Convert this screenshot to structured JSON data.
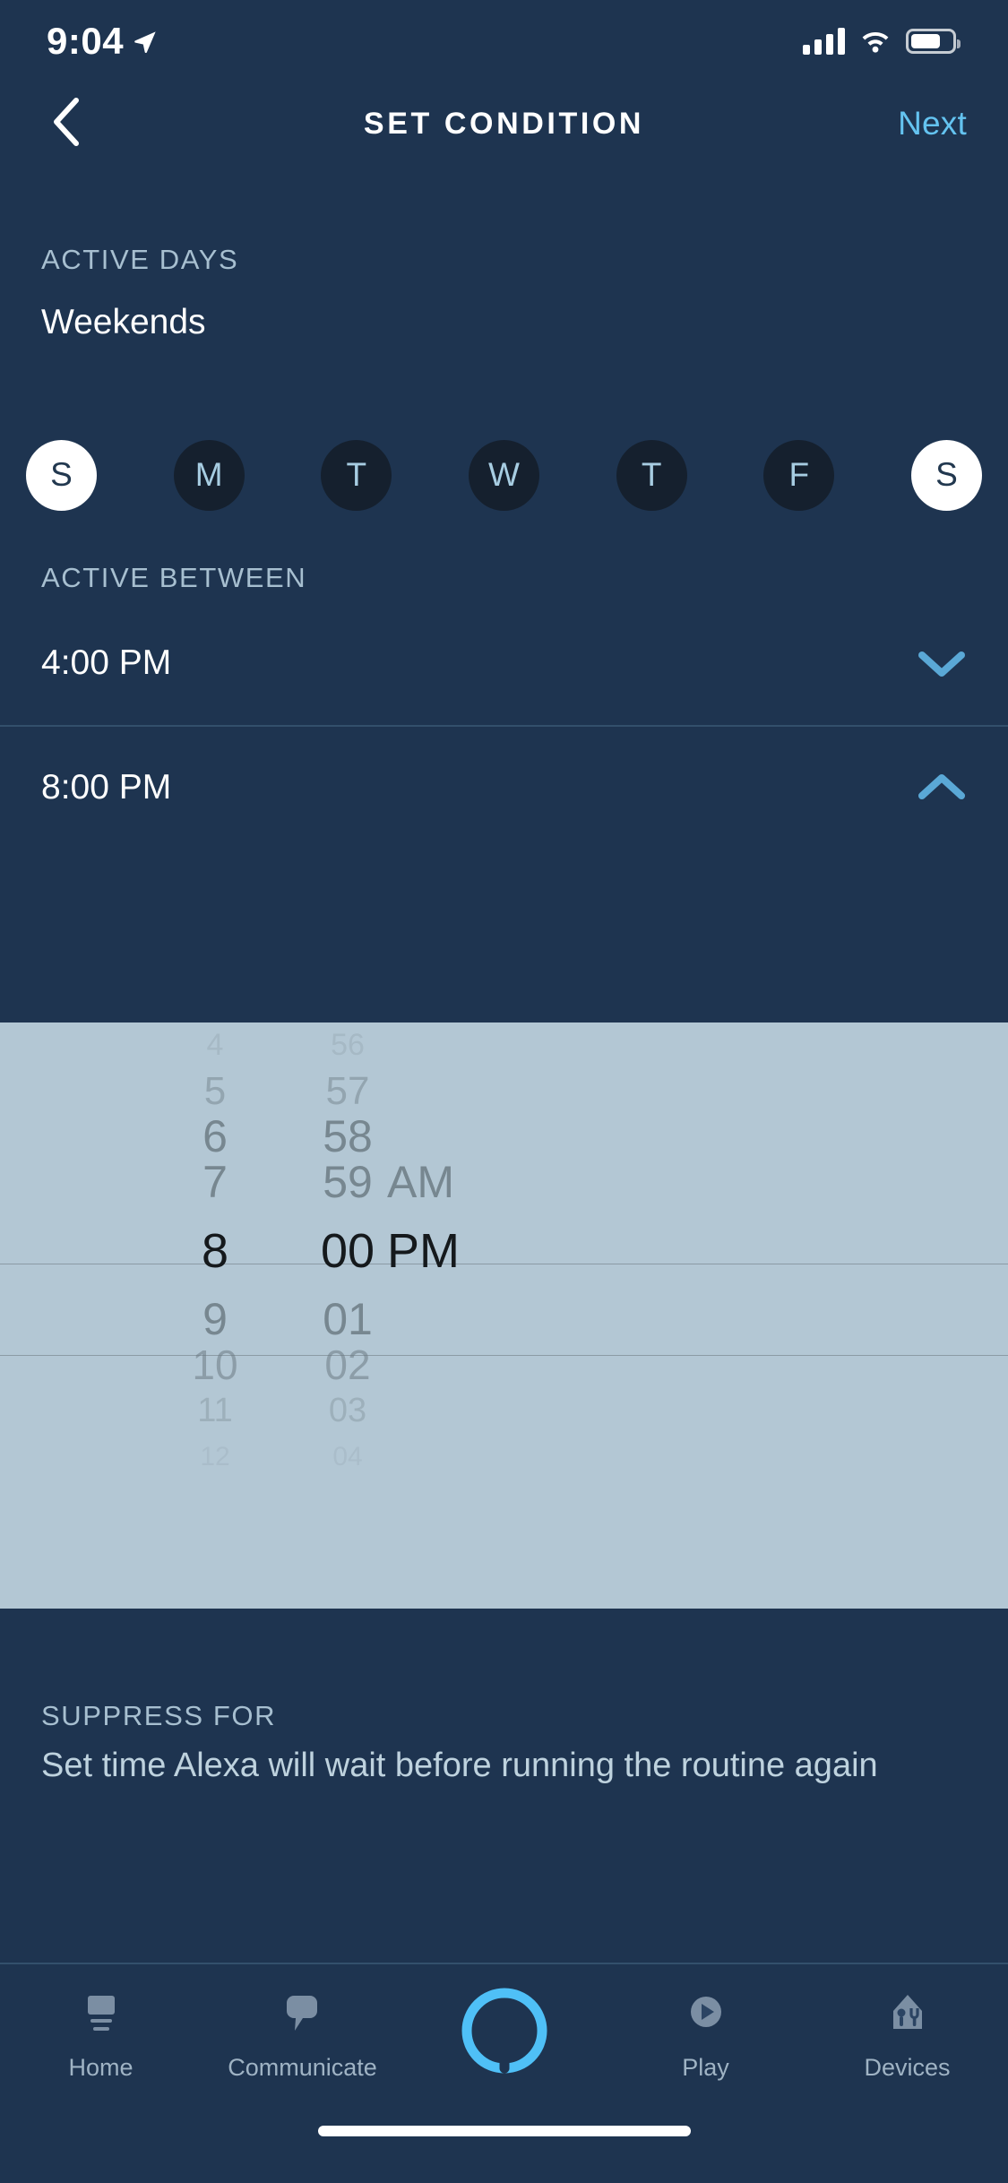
{
  "theme": {
    "bg": "#1e3450",
    "accent": "#64c3f0",
    "muted_label": "#a7bfd0",
    "picker_bg": "#b3c7d4",
    "day_off_bg": "#15202e",
    "day_off_text": "#a7cde2",
    "divider": "#33506c"
  },
  "status_bar": {
    "time": "9:04",
    "location_icon": "location-arrow-icon",
    "cellular_icon": "cellular-bars-icon",
    "wifi_icon": "wifi-icon",
    "battery_icon": "battery-icon"
  },
  "header": {
    "back_icon": "chevron-left-icon",
    "title": "SET CONDITION",
    "next_label": "Next"
  },
  "active_days": {
    "section_label": "ACTIVE DAYS",
    "value": "Weekends",
    "days": [
      {
        "letter": "S",
        "name": "sunday",
        "selected": true
      },
      {
        "letter": "M",
        "name": "monday",
        "selected": false
      },
      {
        "letter": "T",
        "name": "tuesday",
        "selected": false
      },
      {
        "letter": "W",
        "name": "wednesday",
        "selected": false
      },
      {
        "letter": "T",
        "name": "thursday",
        "selected": false
      },
      {
        "letter": "F",
        "name": "friday",
        "selected": false
      },
      {
        "letter": "S",
        "name": "saturday",
        "selected": true
      }
    ]
  },
  "active_between": {
    "section_label": "ACTIVE BETWEEN",
    "start": {
      "value": "4:00 PM",
      "chevron": "chevron-down-icon",
      "expanded": false
    },
    "end": {
      "value": "8:00 PM",
      "chevron": "chevron-up-icon",
      "expanded": true
    }
  },
  "time_picker": {
    "selected": {
      "hour": "8",
      "minute": "00",
      "period": "PM"
    },
    "hours": [
      "4",
      "5",
      "6",
      "7",
      "8",
      "9",
      "10",
      "11",
      "12"
    ],
    "minutes": [
      "56",
      "57",
      "58",
      "59",
      "00",
      "01",
      "02",
      "03",
      "04"
    ],
    "periods": [
      "",
      "",
      "AM",
      "PM",
      "",
      "",
      "",
      ""
    ]
  },
  "suppress_for": {
    "section_label": "SUPPRESS FOR",
    "description": "Set time Alexa will wait before running the routine again"
  },
  "tab_bar": {
    "items": [
      {
        "label": "Home",
        "icon": "home-icon",
        "active": false
      },
      {
        "label": "Communicate",
        "icon": "speech-bubble-icon",
        "active": false
      },
      {
        "label": "",
        "icon": "alexa-ring-icon",
        "active": true
      },
      {
        "label": "Play",
        "icon": "play-circle-icon",
        "active": false
      },
      {
        "label": "Devices",
        "icon": "devices-bulb-icon",
        "active": false
      }
    ]
  }
}
